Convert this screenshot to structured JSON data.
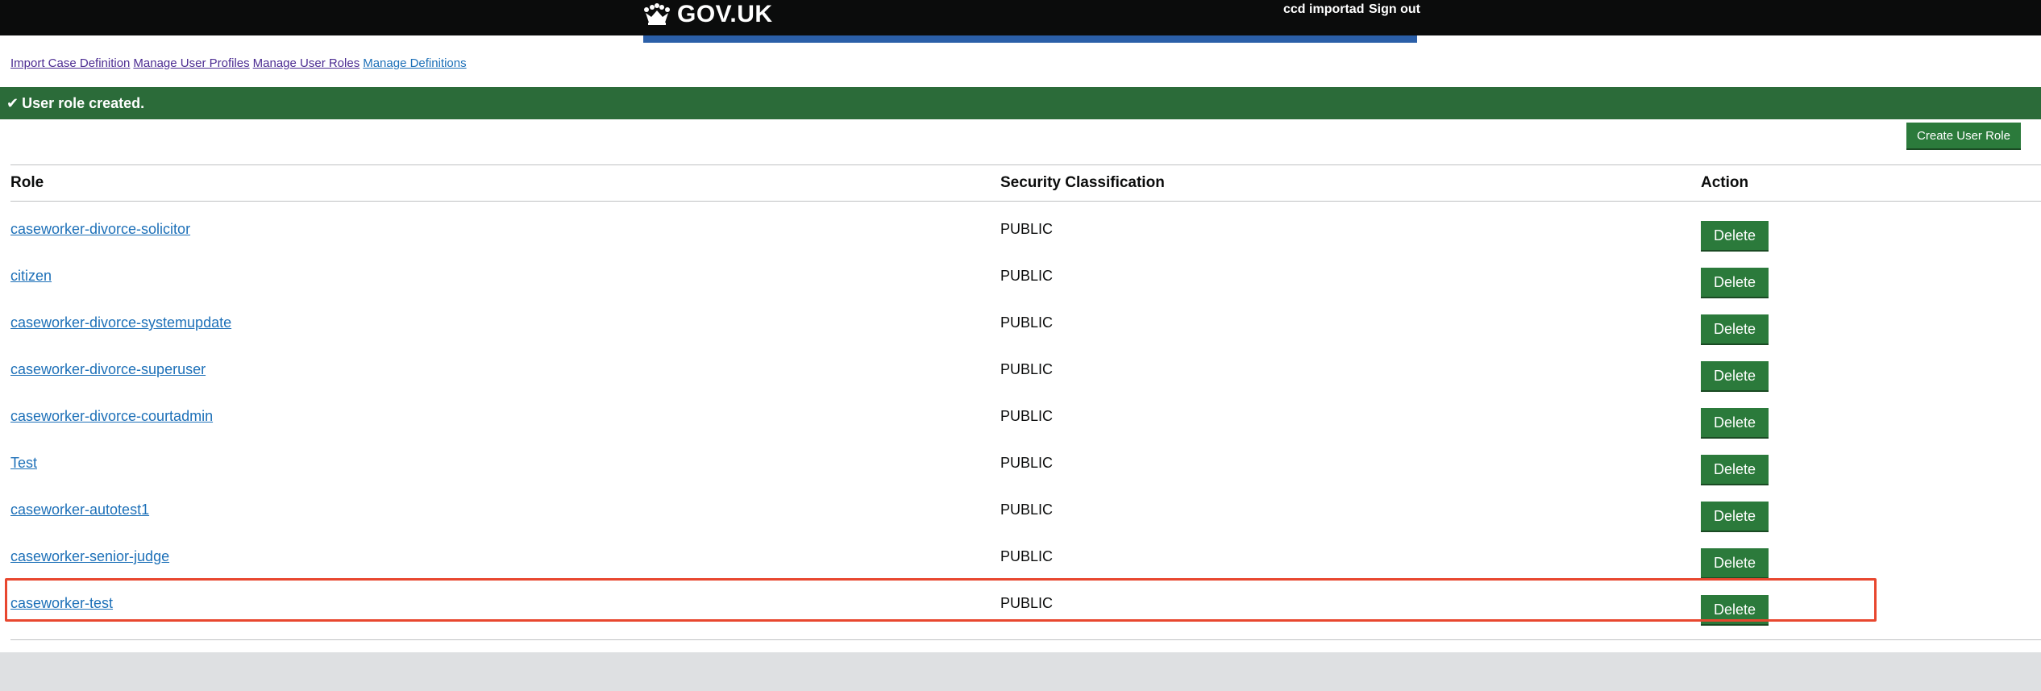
{
  "header": {
    "logo_text": "GOV.UK",
    "user_name": "ccd importad",
    "sign_out": "Sign out"
  },
  "nav": {
    "items": [
      {
        "label": "Import Case Definition"
      },
      {
        "label": "Manage User Profiles"
      },
      {
        "label": "Manage User Roles"
      },
      {
        "label": "Manage Definitions"
      }
    ]
  },
  "banner": {
    "icon": "check-icon",
    "tick": "✔",
    "message": "User role created."
  },
  "toolbar": {
    "create_label": "Create User Role"
  },
  "table": {
    "headers": [
      "Role",
      "Security Classification",
      "Action"
    ],
    "rows": [
      {
        "role": "caseworker-divorce-solicitor",
        "classification": "PUBLIC",
        "action": "Delete"
      },
      {
        "role": "citizen",
        "classification": "PUBLIC",
        "action": "Delete"
      },
      {
        "role": "caseworker-divorce-systemupdate",
        "classification": "PUBLIC",
        "action": "Delete"
      },
      {
        "role": "caseworker-divorce-superuser",
        "classification": "PUBLIC",
        "action": "Delete"
      },
      {
        "role": "caseworker-divorce-courtadmin",
        "classification": "PUBLIC",
        "action": "Delete"
      },
      {
        "role": "Test",
        "classification": "PUBLIC",
        "action": "Delete"
      },
      {
        "role": "caseworker-autotest1",
        "classification": "PUBLIC",
        "action": "Delete"
      },
      {
        "role": "caseworker-senior-judge",
        "classification": "PUBLIC",
        "action": "Delete"
      },
      {
        "role": "caseworker-test",
        "classification": "PUBLIC",
        "action": "Delete"
      }
    ]
  },
  "colors": {
    "header_bg": "#0b0c0c",
    "brand_bar": "#2b5fa8",
    "success_banner": "#2b6b39",
    "button_green": "#2b7a3b",
    "link_blue": "#1d70b8",
    "highlight": "#e8472f"
  }
}
